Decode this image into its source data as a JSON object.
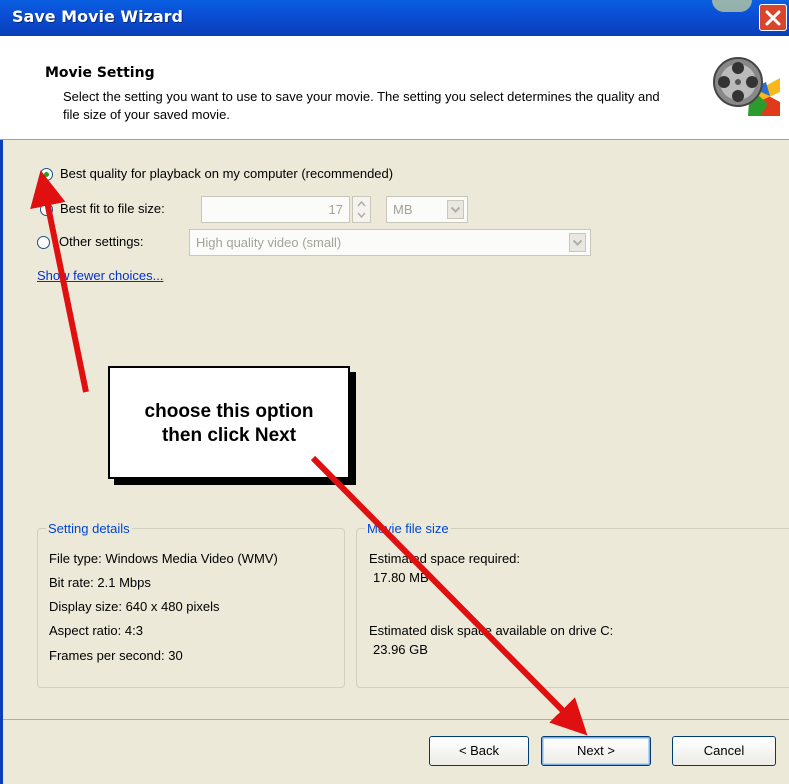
{
  "window": {
    "title": "Save Movie Wizard"
  },
  "header": {
    "title": "Movie Setting",
    "description": "Select the setting you want to use to save your movie. The setting you select determines the quality and file size of your saved movie.",
    "icon": "film-reel-icon"
  },
  "options": {
    "best_quality": {
      "label": "Best quality for playback on my computer (recommended)",
      "selected": true
    },
    "best_fit": {
      "label": "Best fit to file size:",
      "value": "17",
      "unit": "MB",
      "selected": false
    },
    "other": {
      "label": "Other settings:",
      "value": "High quality video (small)",
      "selected": false
    },
    "show_fewer": "Show fewer choices..."
  },
  "callout": {
    "line1": "choose this option",
    "line2": "then click Next",
    "arrow_color": "#e01010"
  },
  "setting_details": {
    "legend": "Setting details",
    "items": [
      "File type: Windows Media Video (WMV)",
      "Bit rate: 2.1 Mbps",
      "Display size: 640 x 480 pixels",
      "Aspect ratio: 4:3",
      "Frames per second: 30"
    ]
  },
  "file_size": {
    "legend": "Movie file size",
    "required_label": "Estimated space required:",
    "required_value": "17.80 MB",
    "available_label": "Estimated disk space available on drive C:",
    "available_value": "23.96 GB"
  },
  "buttons": {
    "back": "< Back",
    "next": "Next >",
    "cancel": "Cancel"
  },
  "colors": {
    "titlebar": "#0a4fd6",
    "dialog_bg": "#ece9d8",
    "legend_text": "#0046d5",
    "radio_dot": "#21a121"
  }
}
